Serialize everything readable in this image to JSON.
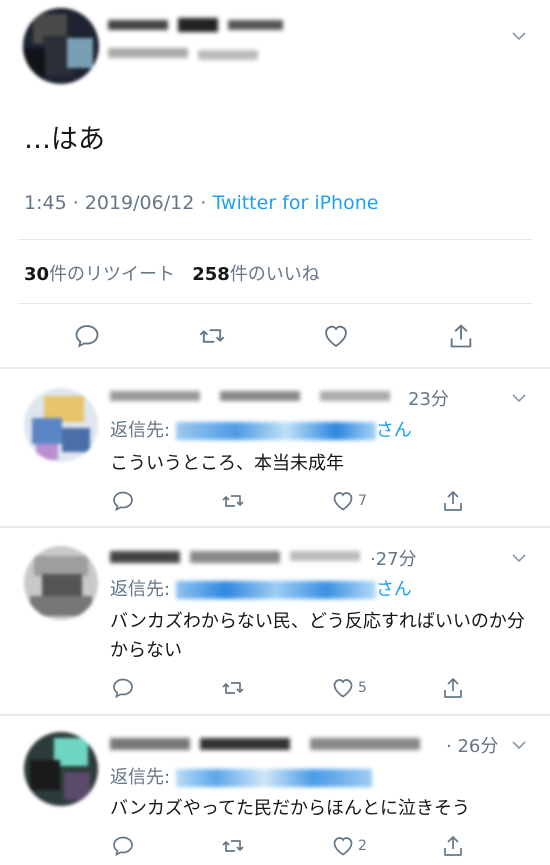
{
  "main_tweet": {
    "text": "…はあ",
    "time": "1:45",
    "date": "2019/06/12",
    "via": "Twitter for iPhone",
    "retweets_count": "30",
    "retweets_label": "件のリツイート",
    "likes_count": "258",
    "likes_label": "件のいいね",
    "separator": " · "
  },
  "replies": [
    {
      "time": "23分",
      "reply_to_label": "返信先:",
      "reply_to_tail": "さん",
      "text": "こういうところ、本当未成年",
      "like_count": "7"
    },
    {
      "time": "·27分",
      "reply_to_label": "返信先:",
      "reply_to_tail": "さん",
      "text": "バンカズわからない民、どう反応すればいいのか分からない",
      "like_count": "5"
    },
    {
      "time": "· 26分",
      "reply_to_label": "返信先:",
      "reply_to_tail": "",
      "text": "バンカズやってた民だからほんとに泣きそう",
      "like_count": "2"
    }
  ],
  "colors": {
    "accent": "#1da1f2",
    "secondary_text": "#657786",
    "icon": "#657786"
  }
}
